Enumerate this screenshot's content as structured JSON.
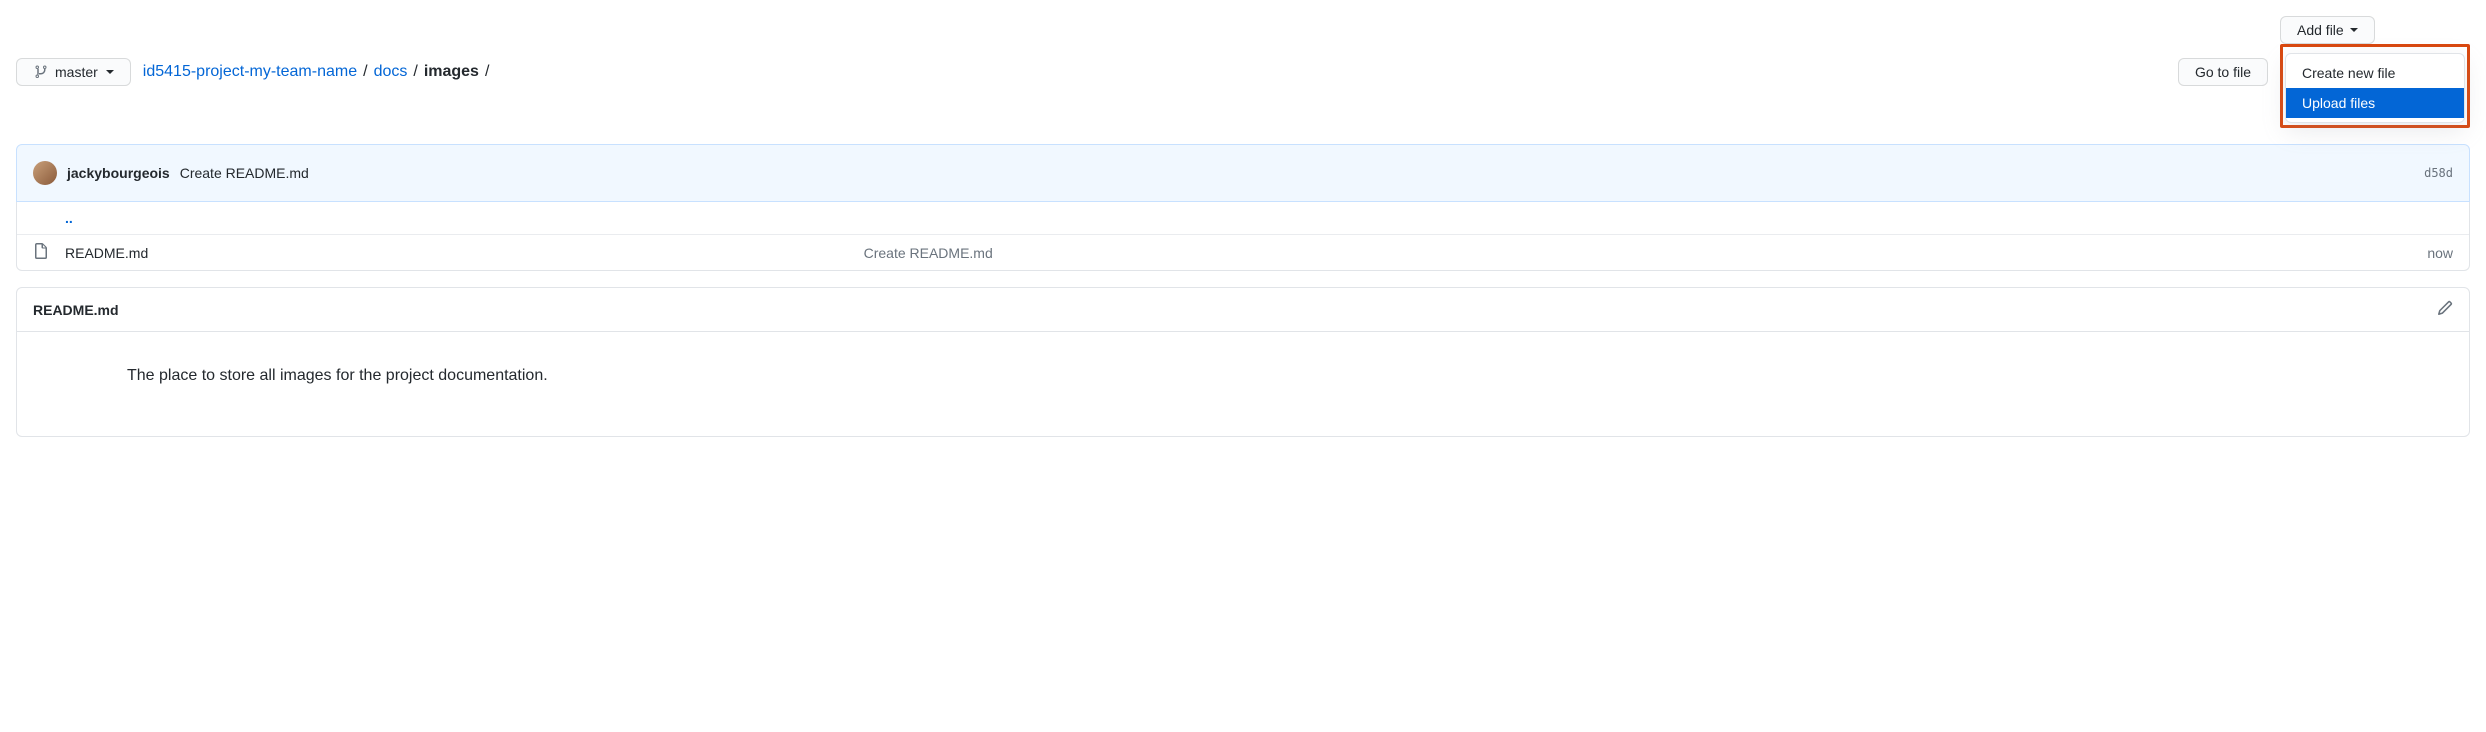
{
  "branch": {
    "label": "master"
  },
  "breadcrumb": {
    "repo": "id5415-project-my-team-name",
    "path1": "docs",
    "current": "images"
  },
  "buttons": {
    "go_to_file": "Go to file",
    "add_file": "Add file"
  },
  "dropdown": {
    "create": "Create new file",
    "upload": "Upload files"
  },
  "commit": {
    "author": "jackybourgeois",
    "message": "Create README.md",
    "sha": "d58d"
  },
  "files": {
    "parent": "..",
    "row1": {
      "name": "README.md",
      "msg": "Create README.md",
      "time": "now"
    }
  },
  "readme": {
    "title": "README.md",
    "body": "The place to store all images for the project documentation."
  }
}
